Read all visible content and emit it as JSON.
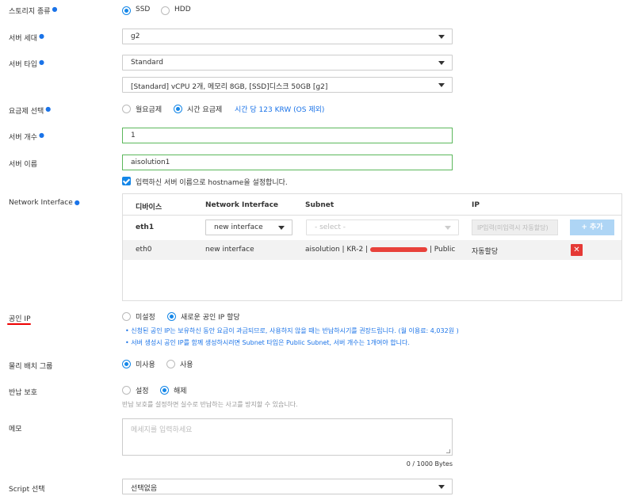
{
  "storage_type": {
    "label": "스토리지 종류",
    "options": [
      "SSD",
      "HDD"
    ],
    "selected": "SSD"
  },
  "server_gen": {
    "label": "서버 세대",
    "value": "g2"
  },
  "server_type": {
    "label": "서버 타입",
    "value": "Standard",
    "spec": "[Standard] vCPU 2개, 메모리 8GB, [SSD]디스크 50GB [g2]"
  },
  "billing": {
    "label": "요금제 선택",
    "options": [
      "월요금제",
      "시간 요금제"
    ],
    "selected": "시간 요금제",
    "price_note": "시간 당 123 KRW (OS 제외)"
  },
  "server_count": {
    "label": "서버 개수",
    "value": "1"
  },
  "server_name": {
    "label": "서버 이름",
    "value": "aisolution1",
    "hostname_check": "입력하신 서버 이름으로 hostname을 설정합니다."
  },
  "network": {
    "label": "Network Interface",
    "headers": [
      "디바이스",
      "Network Interface",
      "Subnet",
      "IP"
    ],
    "new_row": {
      "device": "eth1",
      "nic": "new interface",
      "subnet_placeholder": "- select -",
      "ip_placeholder": "IP입력(미입력시 자동할당)",
      "add_label": "+ 추가"
    },
    "rows": [
      {
        "device": "eth0",
        "nic": "new interface",
        "subnet_prefix": "aisolution | KR-2 |",
        "subnet_suffix": "| Public",
        "ip": "자동할당"
      }
    ]
  },
  "public_ip": {
    "label": "공인 IP",
    "options": [
      "미설정",
      "새로운 공인 IP 할당"
    ],
    "selected": "새로운 공인 IP 할당",
    "notes": [
      "신청된 공인 IP는 보유하신 동안 요금이 과금되므로, 사용하지 않을 때는 반납하시기를 권장드립니다. (월 이용료: 4,032원 )",
      "서버 생성시 공인 IP를 함께 생성하시려면 Subnet 타입은 Public Subnet, 서버 개수는 1개여야 합니다."
    ]
  },
  "placement": {
    "label": "물리 배치 그룹",
    "options": [
      "미사용",
      "사용"
    ],
    "selected": "미사용"
  },
  "return_protect": {
    "label": "반납 보호",
    "options": [
      "설정",
      "해제"
    ],
    "selected": "해제",
    "note": "반납 보호를 설정하면 실수로 반납하는 사고를 방지할 수 있습니다."
  },
  "memo": {
    "label": "메모",
    "placeholder": "메세지를 입력하세요",
    "counter": "0 / 1000 Bytes"
  },
  "script": {
    "label": "Script 선택",
    "value": "선택없음"
  },
  "colors": {
    "accent": "#1587e8",
    "valid": "#5cb85c",
    "danger": "#e53935",
    "add_button": "#aed5f5"
  }
}
